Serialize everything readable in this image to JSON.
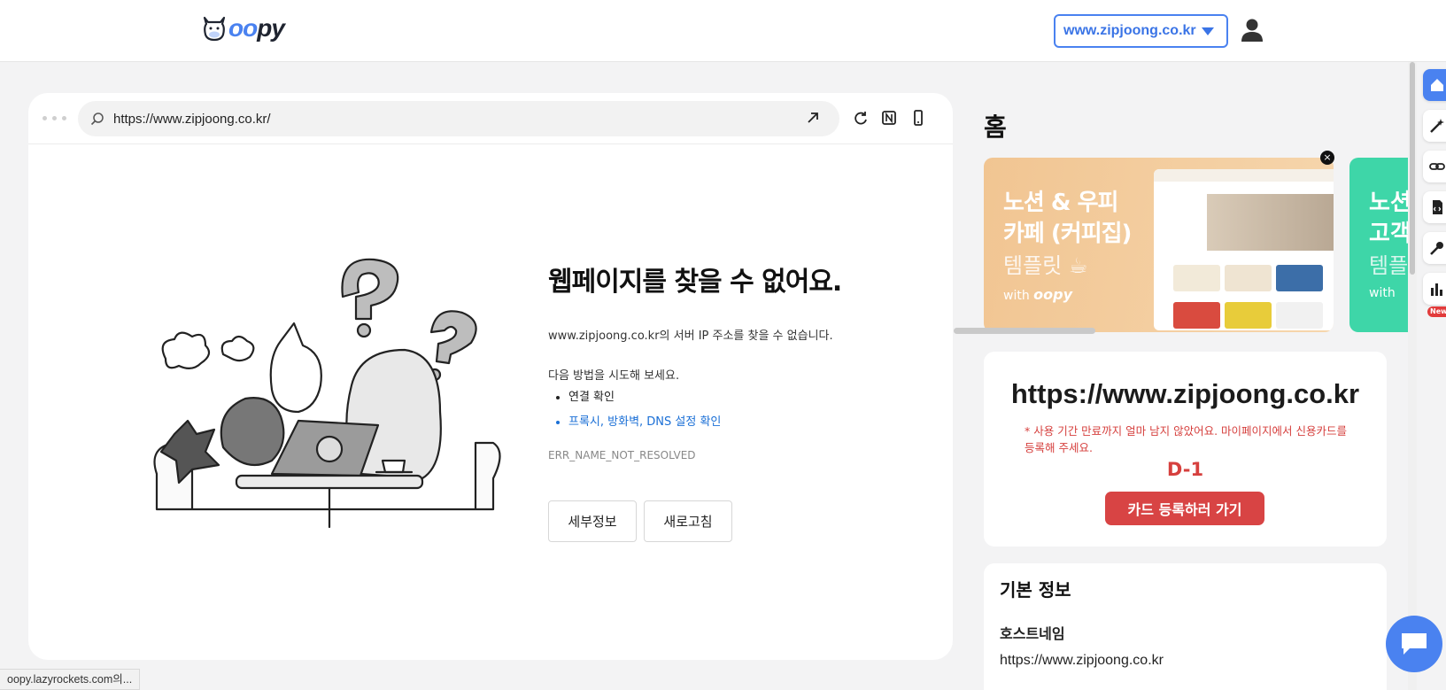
{
  "header": {
    "logo_text_prefix": "oo",
    "logo_text_suffix": "py",
    "site_selector": "www.zipjoong.co.kr"
  },
  "preview": {
    "url": "https://www.zipjoong.co.kr/",
    "error": {
      "title": "웹페이지를 찾을 수 없어요.",
      "description": "www.zipjoong.co.kr의 서버 IP 주소를 찾을 수 없습니다.",
      "try_label": "다음 방법을 시도해 보세요.",
      "suggestions": [
        "연결 확인",
        "프록시, 방화벽, DNS 설정 확인"
      ],
      "code": "ERR_NAME_NOT_RESOLVED",
      "details_button": "세부정보",
      "reload_button": "새로고침"
    }
  },
  "panel": {
    "title": "홈",
    "banner": {
      "line1": "노션 & 우피",
      "line2": "카페 (커피집)",
      "line3": "템플릿 ☕",
      "with_label": "with",
      "brand": "oopy"
    },
    "banner_next": {
      "line1": "노션",
      "line2": "고객",
      "line3": "템플",
      "with_label": "with"
    },
    "subscription": {
      "url": "https://www.zipjoong.co.kr",
      "warning": "* 사용 기간 만료까지 얼마 남지 않았어요. 마이페이지에서 신용카드를 등록해 주세요.",
      "days_left": "D-1",
      "button": "카드 등록하러 가기"
    },
    "basic_info": {
      "title": "기본 정보",
      "hostname_label": "호스트네임",
      "hostname_value": "https://www.zipjoong.co.kr"
    }
  },
  "sidebar": {
    "items": [
      "home-icon",
      "magic-wand-icon",
      "link-icon",
      "code-file-icon",
      "wrench-icon",
      "chart-icon"
    ],
    "new_badge": "New"
  },
  "status_bar": "oopy.lazyrockets.com의...",
  "colors": {
    "accent": "#4a82f0",
    "warning": "#d6403e",
    "link": "#1a6fd6"
  }
}
